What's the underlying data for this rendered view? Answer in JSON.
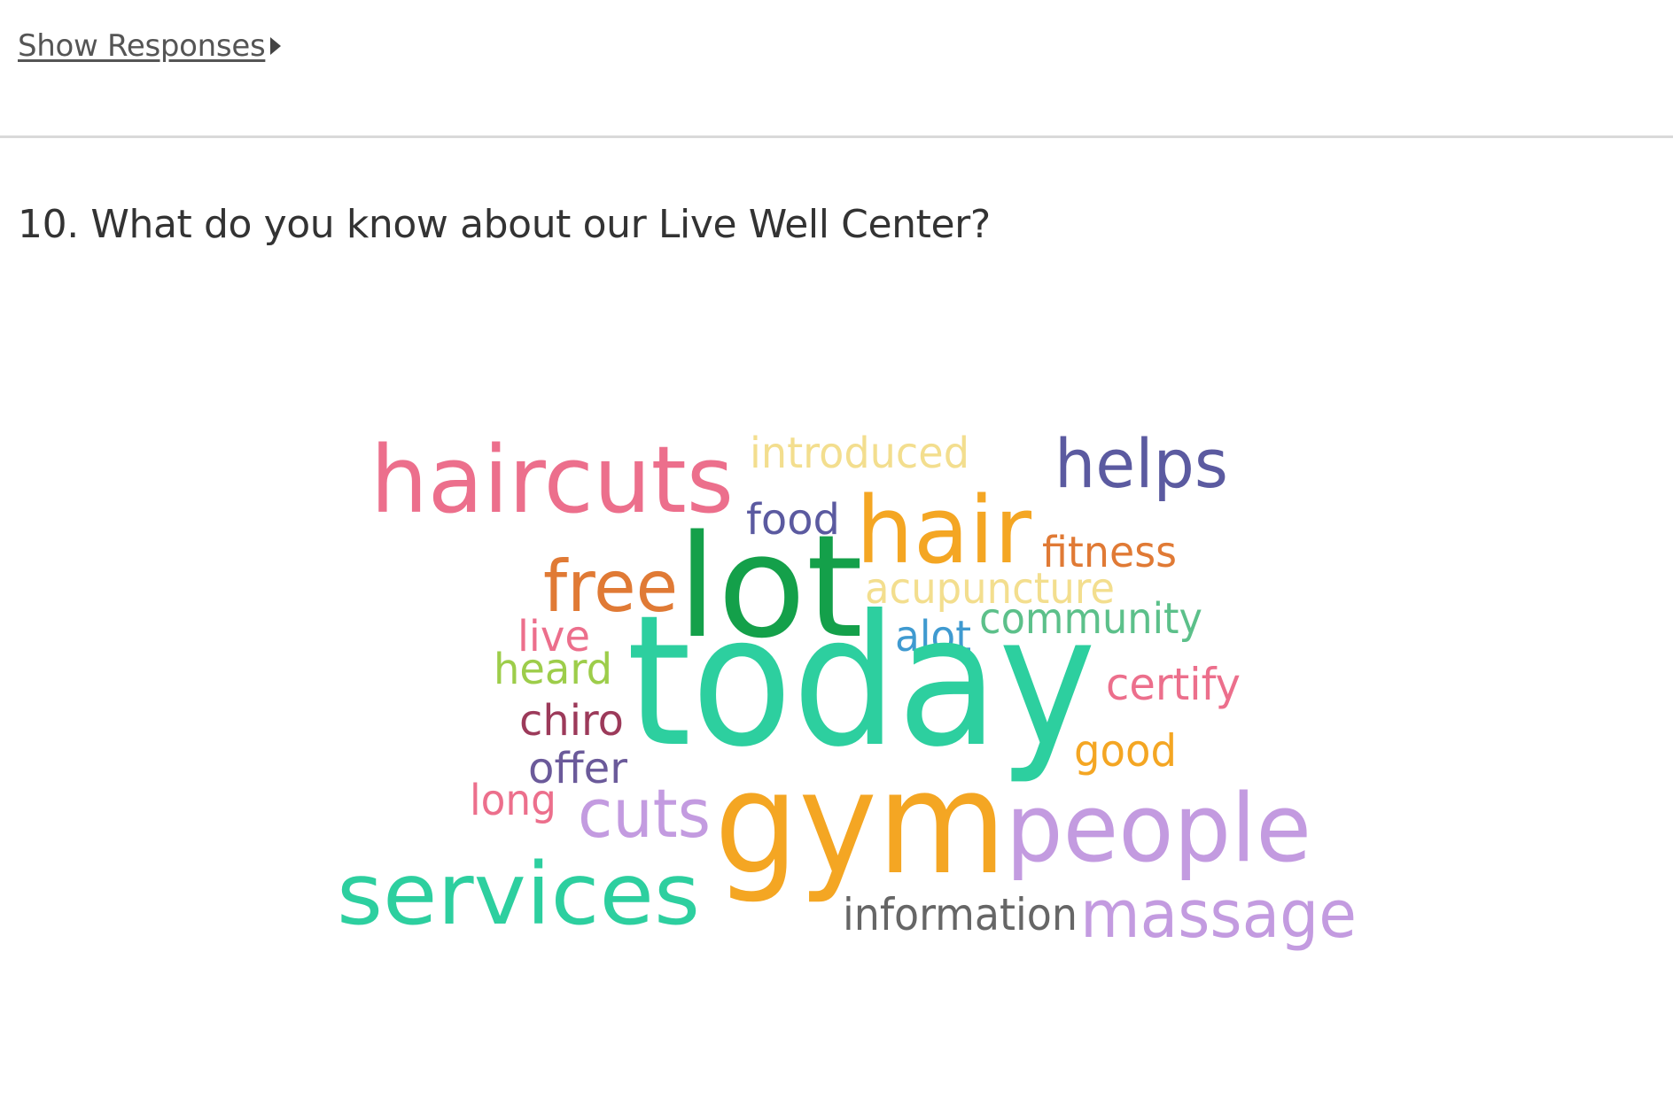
{
  "toggle": {
    "label": "Show Responses"
  },
  "question": {
    "title": "10. What do you know about our Live Well Center?"
  },
  "word_cloud": {
    "words": [
      {
        "text": "haircuts",
        "color": "#ec6f8c"
      },
      {
        "text": "introduced",
        "color": "#f3de8e"
      },
      {
        "text": "helps",
        "color": "#5b5aa0"
      },
      {
        "text": "food",
        "color": "#5b5aa0"
      },
      {
        "text": "hair",
        "color": "#f4a623"
      },
      {
        "text": "fitness",
        "color": "#e07a35"
      },
      {
        "text": "free",
        "color": "#e07a35"
      },
      {
        "text": "lot",
        "color": "#14a04a"
      },
      {
        "text": "acupuncture",
        "color": "#f3de8e"
      },
      {
        "text": "live",
        "color": "#ec6f8c"
      },
      {
        "text": "alot",
        "color": "#3f9ad0"
      },
      {
        "text": "community",
        "color": "#5cc08a"
      },
      {
        "text": "heard",
        "color": "#9dcd4a"
      },
      {
        "text": "today",
        "color": "#2dcf9f"
      },
      {
        "text": "certify",
        "color": "#ec6f8c"
      },
      {
        "text": "chiro",
        "color": "#9c3a5a"
      },
      {
        "text": "offer",
        "color": "#6b5a9a"
      },
      {
        "text": "good",
        "color": "#f4a623"
      },
      {
        "text": "long",
        "color": "#ec6f8c"
      },
      {
        "text": "cuts",
        "color": "#c39be0"
      },
      {
        "text": "gym",
        "color": "#f4a623"
      },
      {
        "text": "people",
        "color": "#c39be0"
      },
      {
        "text": "services",
        "color": "#2dcf9f"
      },
      {
        "text": "information",
        "color": "#666666"
      },
      {
        "text": "massage",
        "color": "#c39be0"
      }
    ]
  }
}
